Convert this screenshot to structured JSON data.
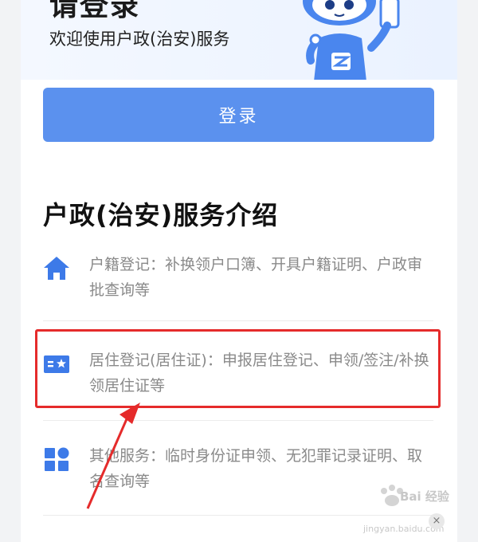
{
  "hero": {
    "title": "请登录",
    "subtitle": "欢迎使用户政(治安)服务"
  },
  "login_button": {
    "label": "登录"
  },
  "section": {
    "title": "户政(治安)服务介绍"
  },
  "services": [
    {
      "icon": "home-icon",
      "text": "户籍登记：补换领户口簿、开具户籍证明、户政审批查询等"
    },
    {
      "icon": "id-card-icon",
      "text": "居住登记(居住证)：申报居住登记、申领/签注/补换领居住证等"
    },
    {
      "icon": "grid-icon",
      "text": "其他服务：临时身份证申领、无犯罪记录证明、取名查询等"
    }
  ],
  "colors": {
    "accent": "#5b91ee",
    "highlight": "#e52b2b",
    "icon": "#3d7ae8"
  },
  "watermark": {
    "text": "Bai 经验",
    "sub": "jingyan.baidu.com"
  }
}
